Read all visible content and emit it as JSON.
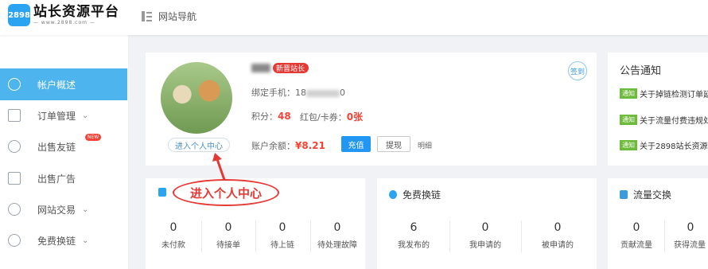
{
  "header": {
    "logo_badge": "2898",
    "logo_title": "站长资源平台",
    "logo_url": "— www.2898.com —",
    "nav_link": "网站导航"
  },
  "sidebar": {
    "items": [
      {
        "label": "帐户概述",
        "icon": "user-circle-icon",
        "active": true
      },
      {
        "label": "订单管理",
        "icon": "document-icon",
        "chevron": "⌄"
      },
      {
        "label": "出售友链",
        "icon": "share-icon",
        "badge": "NEW"
      },
      {
        "label": "出售广告",
        "icon": "image-icon"
      },
      {
        "label": "网站交易",
        "icon": "globe-icon",
        "chevron": "⌄"
      },
      {
        "label": "免费换链",
        "icon": "heart-link-icon",
        "chevron": "⌄"
      }
    ]
  },
  "profile": {
    "vip_badge": "新晋站长",
    "avatar_button": "进入个人中心",
    "sign_in": "签到",
    "phone_label": "绑定手机：",
    "phone_prefix": "18",
    "phone_suffix": "0",
    "points_label": "积分：",
    "points_value": "48",
    "coupon_label": "红包/卡券：",
    "coupon_value": "0张",
    "balance_label": "账户余额：",
    "balance_value": "¥8.21",
    "recharge_button": "充值",
    "withdraw_button": "提现",
    "detail_link": "明细"
  },
  "notice": {
    "title": "公告通知",
    "tag": "通知",
    "items": [
      "关于掉链检测订单延",
      "关于流量付费违规处",
      "关于2898站长资源平"
    ]
  },
  "annotation": {
    "callout": "进入个人中心"
  },
  "orders": {
    "stats": [
      {
        "value": "0",
        "label": "未付款"
      },
      {
        "value": "0",
        "label": "待接单"
      },
      {
        "value": "0",
        "label": "待上链"
      },
      {
        "value": "0",
        "label": "待处理故障"
      }
    ]
  },
  "free_exchange": {
    "title": "免费换链",
    "stats": [
      {
        "value": "6",
        "label": "我发布的"
      },
      {
        "value": "0",
        "label": "我申请的"
      },
      {
        "value": "0",
        "label": "被申请的"
      }
    ]
  },
  "traffic": {
    "title": "流量交换",
    "stats": [
      {
        "value": "0",
        "label": "贡献流量"
      },
      {
        "value": "0",
        "label": "获得流量"
      }
    ]
  },
  "colors": {
    "accent": "#4db4ee",
    "brand_blue": "#2196f3",
    "alert_red": "#e53935",
    "notice_green": "#6dbb3a"
  }
}
